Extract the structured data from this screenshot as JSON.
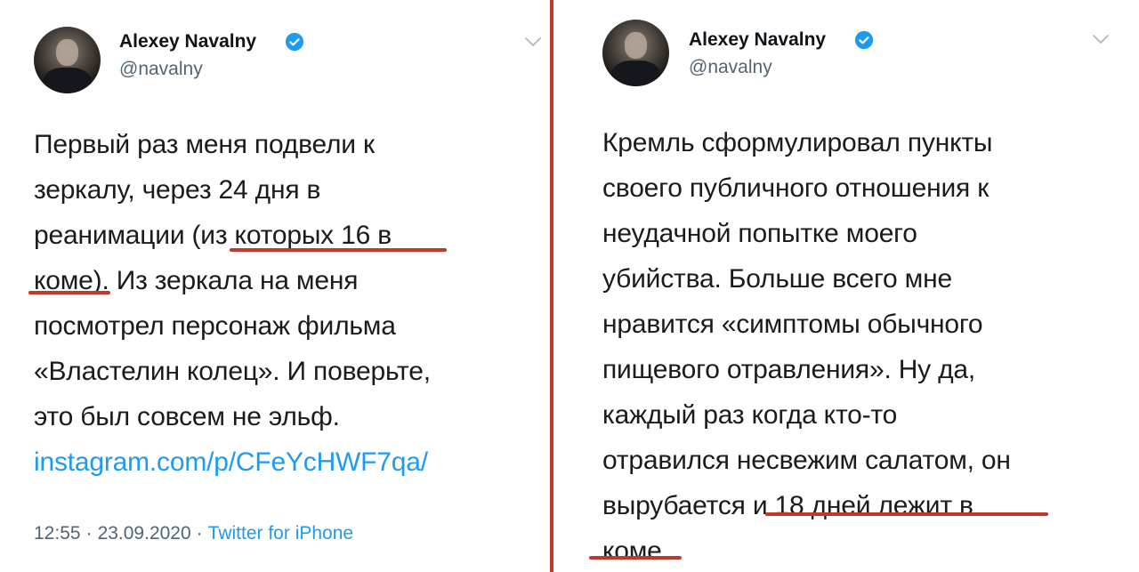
{
  "left_tweet": {
    "display_name": "Alexey Navalny",
    "handle": "@navalny",
    "lines": [
      "Первый раз меня подвели к",
      "зеркалу, через 24 дня в",
      "реанимации (из которых 16 в",
      "коме). Из зеркала на меня",
      "посмотрел персонаж фильма",
      "«Властелин колец». И поверьте,",
      "это был совсем не эльф."
    ],
    "link": "instagram.com/p/CFeYcHWF7qa/",
    "time": "12:55",
    "date": "23.09.2020",
    "separator": "·",
    "source": "Twitter for iPhone"
  },
  "right_tweet": {
    "display_name": "Alexey Navalny",
    "handle": "@navalny",
    "lines": [
      "Кремль сформулировал пункты",
      "своего публичного отношения к",
      "неудачной попытке моего",
      "убийства. Больше всего мне",
      "нравится «симптомы обычного",
      "пищевого отравления». Ну да,",
      "каждый раз когда кто-то",
      "отравился несвежим салатом,  он",
      "вырубается и 18 дней лежит в",
      "коме."
    ]
  },
  "colors": {
    "highlight_underline": "#c0392b",
    "link": "#1d9bf0",
    "verified_badge": "#1d9bf0",
    "secondary_text": "#536471"
  }
}
